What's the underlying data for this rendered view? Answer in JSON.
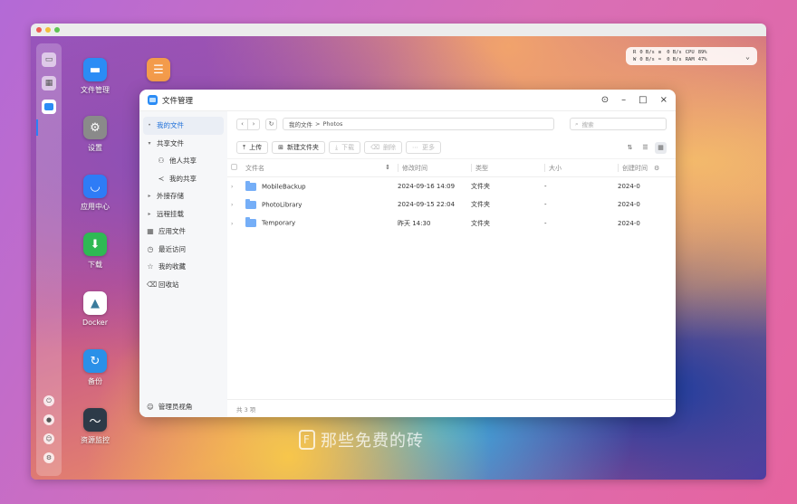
{
  "colors": {
    "accent": "#2b82f6",
    "folder": "#75aef7"
  },
  "desktop": {
    "icons": [
      {
        "label": "文件管理",
        "icon": "folder-icon",
        "color": "#2b8cf5"
      },
      {
        "label": "设置",
        "icon": "gear-icon",
        "color": "#8a8a8a"
      },
      {
        "label": "应用中心",
        "icon": "store-icon",
        "color": "#2e7cf6"
      },
      {
        "label": "下载",
        "icon": "download-icon",
        "color": "#2fb954"
      },
      {
        "label": "Docker",
        "icon": "docker-icon",
        "color": "#3a7b9c"
      },
      {
        "label": "备份",
        "icon": "backup-icon",
        "color": "#2a90e8"
      },
      {
        "label": "资源监控",
        "icon": "monitor-icon",
        "color": "#2d3a48"
      }
    ]
  },
  "sysmon": {
    "r_label": "R",
    "w_label": "W",
    "r_rate": "0 B/s",
    "w_rate": "0 B/s",
    "r2_rate": "0 B/s",
    "w2_rate": "0 B/s",
    "cpu_label": "CPU",
    "cpu_value": "89%",
    "ram_label": "RAM",
    "ram_value": "47%"
  },
  "window": {
    "title": "文件管理",
    "sidebar": {
      "items": [
        {
          "label": "我的文件",
          "active": true
        },
        {
          "label": "共享文件"
        },
        {
          "label": "他人共享"
        },
        {
          "label": "我的共享"
        },
        {
          "label": "外接存储"
        },
        {
          "label": "远程挂载"
        },
        {
          "label": "应用文件"
        },
        {
          "label": "最近访问"
        },
        {
          "label": "我的收藏"
        },
        {
          "label": "回收站"
        }
      ],
      "footer": "管理员视角"
    },
    "breadcrumb": {
      "root": "我的文件",
      "sep": ">",
      "current": "Photos"
    },
    "search_placeholder": "搜索",
    "toolbar": {
      "upload": "上传",
      "new_folder": "新建文件夹",
      "download": "下载",
      "delete": "删除",
      "more": "更多"
    },
    "table": {
      "headers": [
        "文件名",
        "修改时间",
        "类型",
        "大小",
        "创建时间"
      ],
      "rows": [
        {
          "name": "MobileBackup",
          "modified": "2024-09-16 14:09",
          "type": "文件夹",
          "size": "-",
          "created": "2024-0"
        },
        {
          "name": "PhotoLibrary",
          "modified": "2024-09-15 22:04",
          "type": "文件夹",
          "size": "-",
          "created": "2024-0"
        },
        {
          "name": "Temporary",
          "modified": "昨天 14:30",
          "type": "文件夹",
          "size": "-",
          "created": "2024-0"
        }
      ]
    },
    "status": "共 3 项"
  },
  "watermark": "那些免费的砖"
}
